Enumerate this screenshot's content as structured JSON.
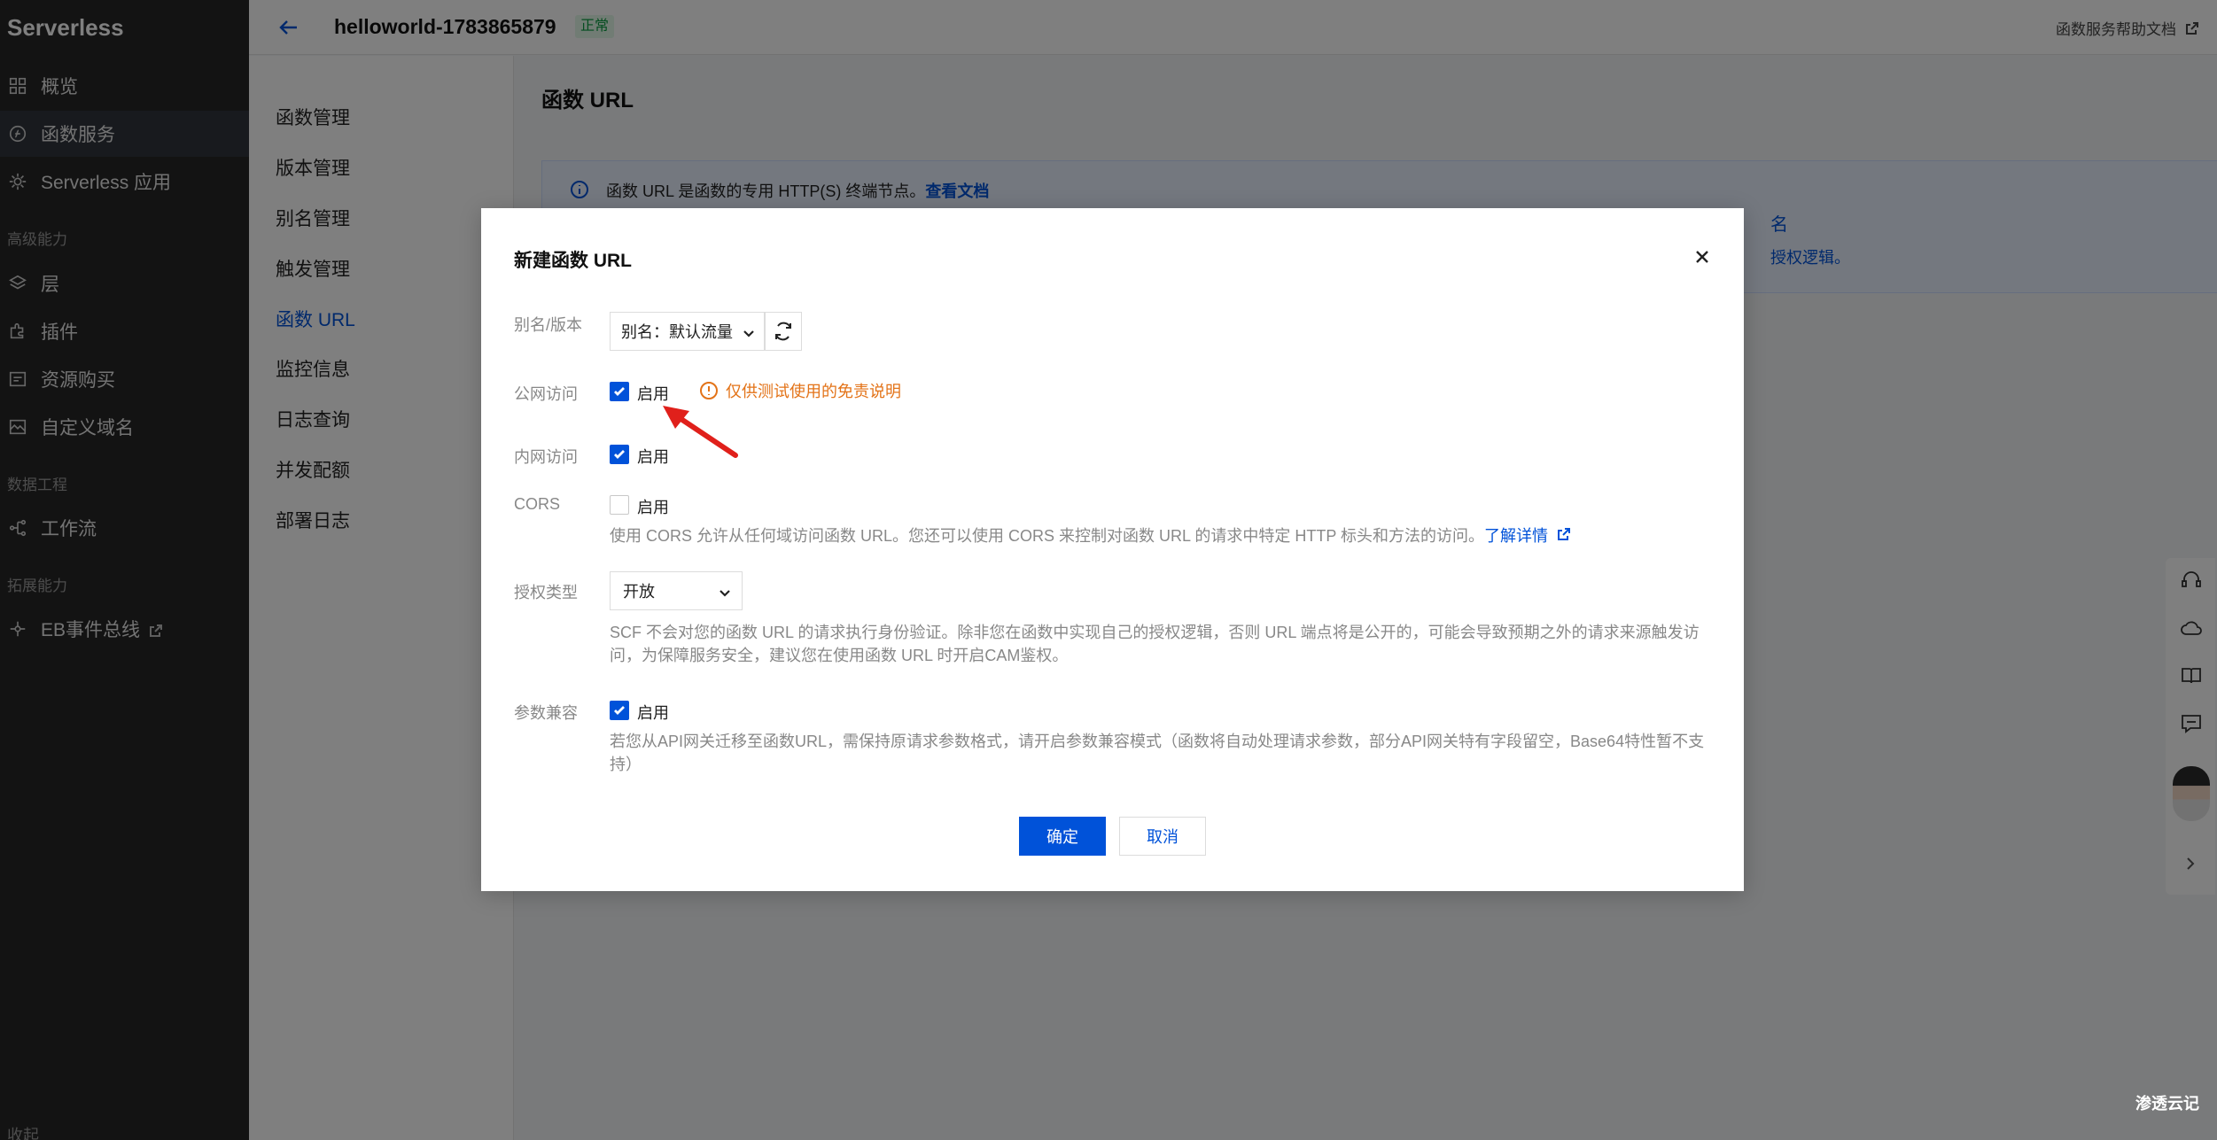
{
  "nav": {
    "brand": "Serverless",
    "items": [
      {
        "label": "概览"
      },
      {
        "label": "函数服务"
      },
      {
        "label": "Serverless 应用"
      },
      {
        "label": "层"
      },
      {
        "label": "插件"
      },
      {
        "label": "资源购买"
      },
      {
        "label": "自定义域名"
      },
      {
        "label": "工作流"
      },
      {
        "label": "EB事件总线"
      }
    ],
    "groups": [
      "高级能力",
      "数据工程",
      "拓展能力"
    ],
    "collapse": "收起"
  },
  "header": {
    "function_name": "helloworld-1783865879",
    "status": "正常",
    "help_link": "函数服务帮助文档"
  },
  "submenu": {
    "items": [
      "函数管理",
      "版本管理",
      "别名管理",
      "触发管理",
      "函数 URL",
      "监控信息",
      "日志查询",
      "并发配额",
      "部署日志"
    ]
  },
  "main": {
    "title": "函数 URL",
    "info_text": "函数 URL 是函数的专用 HTTP(S) 终端节点。",
    "info_link": "查看文档",
    "info_right_1": "名",
    "info_right_2": "授权逻辑。"
  },
  "dialog": {
    "title": "新建函数 URL",
    "alias_label": "别名/版本",
    "alias_value": "别名：默认流量",
    "public_label": "公网访问",
    "public_checked": true,
    "enable_label": "启用",
    "public_warning": "仅供测试使用的免责说明",
    "private_label": "内网访问",
    "private_checked": true,
    "cors_label": "CORS",
    "cors_checked": false,
    "cors_desc": "使用 CORS 允许从任何域访问函数 URL。您还可以使用 CORS 来控制对函数 URL 的请求中特定 HTTP 标头和方法的访问。",
    "cors_link": "了解详情",
    "auth_label": "授权类型",
    "auth_value": "开放",
    "auth_desc": "SCF 不会对您的函数 URL 的请求执行身份验证。除非您在函数中实现自己的授权逻辑，否则 URL 端点将是公开的，可能会导致预期之外的请求来源触发访问，为保障服务安全，建议您在使用函数 URL 时开启CAM鉴权。",
    "compat_label": "参数兼容",
    "compat_checked": true,
    "compat_desc": "若您从API网关迁移至函数URL，需保持原请求参数格式，请开启参数兼容模式（函数将自动处理请求参数，部分API网关特有字段留空，Base64特性暂不支持）",
    "confirm": "确定",
    "cancel": "取消"
  },
  "watermark": "渗透云记",
  "colors": {
    "primary": "#0052d9",
    "warning": "#e37318",
    "annotation_arrow": "#e0201b"
  }
}
